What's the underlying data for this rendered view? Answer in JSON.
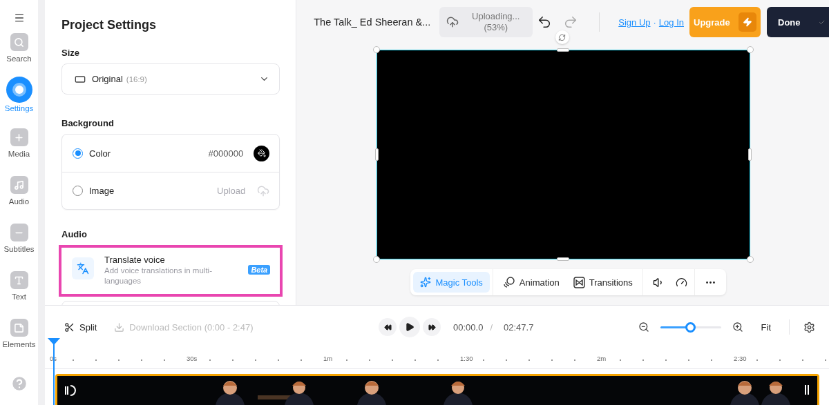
{
  "sidebar": {
    "items": [
      {
        "label": "Search",
        "selected": false
      },
      {
        "label": "Settings",
        "selected": true
      },
      {
        "label": "Media",
        "selected": false
      },
      {
        "label": "Audio",
        "selected": false
      },
      {
        "label": "Subtitles",
        "selected": false
      },
      {
        "label": "Text",
        "selected": false
      },
      {
        "label": "Elements",
        "selected": false
      }
    ]
  },
  "settings_panel": {
    "title": "Project Settings",
    "size": {
      "label": "Size",
      "value": "Original",
      "ratio": "(16:9)"
    },
    "background": {
      "label": "Background",
      "options": [
        {
          "kind": "color",
          "label": "Color",
          "selected": true,
          "value": "#000000"
        },
        {
          "label": "Image",
          "selected": false,
          "action": "Upload"
        }
      ]
    },
    "audio": {
      "label": "Audio",
      "items": [
        {
          "title": "Translate voice",
          "description": "Add voice translations in multi-languages",
          "badge": "Beta",
          "highlighted": true
        }
      ]
    }
  },
  "header": {
    "title": "The Talk_ Ed Sheeran &...",
    "upload_status": [
      "Uploading...",
      "(53%)"
    ],
    "links": [
      "Sign Up",
      "Log In"
    ],
    "link_separator": "·",
    "upgrade": "Upgrade",
    "done": "Done"
  },
  "toolbar": {
    "items": [
      {
        "label": "Magic Tools",
        "selected": true
      },
      {
        "label": "Animation",
        "selected": false
      },
      {
        "label": "Transitions",
        "selected": false
      }
    ]
  },
  "timeline": {
    "split": "Split",
    "download": {
      "label": "Download Section (0:00 - 2:47)",
      "disabled": true
    },
    "current_time": "00:00.0",
    "time_separator": "/",
    "total_time": "02:47.7",
    "zoom": {
      "level": 0.49
    },
    "fit": "Fit",
    "ruler": [
      "0s",
      "30s",
      "1m",
      "1:30",
      "2m",
      "2:30"
    ]
  }
}
